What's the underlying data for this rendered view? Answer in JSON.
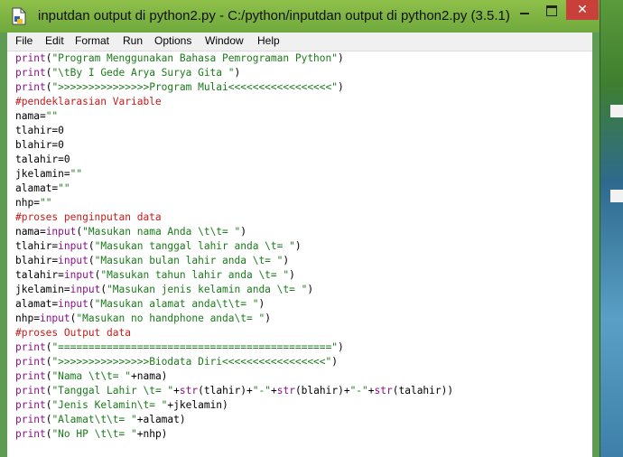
{
  "window": {
    "title": "inputdan output di python2.py - C:/python/inputdan output di python2.py (3.5.1)",
    "close_symbol": "✕"
  },
  "menu": [
    "File",
    "Edit",
    "Format",
    "Run",
    "Options",
    "Window",
    "Help"
  ],
  "colors": {
    "keyword": "#8b0f8b",
    "string": "#1a7a1a",
    "comment": "#c81a1a",
    "titlebar": "#7db443",
    "close": "#c7403a"
  },
  "code_lines": [
    [
      [
        "kw",
        "print"
      ],
      [
        "plain",
        "("
      ],
      [
        "str",
        "\"Program Menggunakan Bahasa Pemrograman Python\""
      ],
      [
        "plain",
        ")"
      ]
    ],
    [
      [
        "kw",
        "print"
      ],
      [
        "plain",
        "("
      ],
      [
        "str",
        "\"\\tBy I Gede Arya Surya Gita \""
      ],
      [
        "plain",
        ")"
      ]
    ],
    [
      [
        "kw",
        "print"
      ],
      [
        "plain",
        "("
      ],
      [
        "str",
        "\">>>>>>>>>>>>>>>Program Mulai<<<<<<<<<<<<<<<<<\""
      ],
      [
        "plain",
        ")"
      ]
    ],
    [
      [
        "cmt",
        "#pendeklarasian Variable"
      ]
    ],
    [
      [
        "plain",
        "nama="
      ],
      [
        "str",
        "\"\""
      ]
    ],
    [
      [
        "plain",
        "tlahir=0"
      ]
    ],
    [
      [
        "plain",
        "blahir=0"
      ]
    ],
    [
      [
        "plain",
        "talahir=0"
      ]
    ],
    [
      [
        "plain",
        "jkelamin="
      ],
      [
        "str",
        "\"\""
      ]
    ],
    [
      [
        "plain",
        "alamat="
      ],
      [
        "str",
        "\"\""
      ]
    ],
    [
      [
        "plain",
        "nhp="
      ],
      [
        "str",
        "\"\""
      ]
    ],
    [
      [
        "cmt",
        "#proses penginputan data"
      ]
    ],
    [
      [
        "plain",
        "nama="
      ],
      [
        "kw",
        "input"
      ],
      [
        "plain",
        "("
      ],
      [
        "str",
        "\"Masukan nama Anda \\t\\t= \""
      ],
      [
        "plain",
        ")"
      ]
    ],
    [
      [
        "plain",
        "tlahir="
      ],
      [
        "kw",
        "input"
      ],
      [
        "plain",
        "("
      ],
      [
        "str",
        "\"Masukan tanggal lahir anda \\t= \""
      ],
      [
        "plain",
        ")"
      ]
    ],
    [
      [
        "plain",
        "blahir="
      ],
      [
        "kw",
        "input"
      ],
      [
        "plain",
        "("
      ],
      [
        "str",
        "\"Masukan bulan lahir anda \\t= \""
      ],
      [
        "plain",
        ")"
      ]
    ],
    [
      [
        "plain",
        "talahir="
      ],
      [
        "kw",
        "input"
      ],
      [
        "plain",
        "("
      ],
      [
        "str",
        "\"Masukan tahun lahir anda \\t= \""
      ],
      [
        "plain",
        ")"
      ]
    ],
    [
      [
        "plain",
        "jkelamin="
      ],
      [
        "kw",
        "input"
      ],
      [
        "plain",
        "("
      ],
      [
        "str",
        "\"Masukan jenis kelamin anda \\t= \""
      ],
      [
        "plain",
        ")"
      ]
    ],
    [
      [
        "plain",
        "alamat="
      ],
      [
        "kw",
        "input"
      ],
      [
        "plain",
        "("
      ],
      [
        "str",
        "\"Masukan alamat anda\\t\\t= \""
      ],
      [
        "plain",
        ")"
      ]
    ],
    [
      [
        "plain",
        "nhp="
      ],
      [
        "kw",
        "input"
      ],
      [
        "plain",
        "("
      ],
      [
        "str",
        "\"Masukan no handphone anda\\t= \""
      ],
      [
        "plain",
        ")"
      ]
    ],
    [
      [
        "cmt",
        "#proses Output data"
      ]
    ],
    [
      [
        "kw",
        "print"
      ],
      [
        "plain",
        "("
      ],
      [
        "str",
        "\"=============================================\""
      ],
      [
        "plain",
        ")"
      ]
    ],
    [
      [
        "kw",
        "print"
      ],
      [
        "plain",
        "("
      ],
      [
        "str",
        "\">>>>>>>>>>>>>>>Biodata Diri<<<<<<<<<<<<<<<<<\""
      ],
      [
        "plain",
        ")"
      ]
    ],
    [
      [
        "kw",
        "print"
      ],
      [
        "plain",
        "("
      ],
      [
        "str",
        "\"Nama \\t\\t= \""
      ],
      [
        "plain",
        "+nama)"
      ]
    ],
    [
      [
        "kw",
        "print"
      ],
      [
        "plain",
        "("
      ],
      [
        "str",
        "\"Tanggal Lahir \\t= \""
      ],
      [
        "plain",
        "+"
      ],
      [
        "kw",
        "str"
      ],
      [
        "plain",
        "(tlahir)+"
      ],
      [
        "str",
        "\"-\""
      ],
      [
        "plain",
        "+"
      ],
      [
        "kw",
        "str"
      ],
      [
        "plain",
        "(blahir)+"
      ],
      [
        "str",
        "\"-\""
      ],
      [
        "plain",
        "+"
      ],
      [
        "kw",
        "str"
      ],
      [
        "plain",
        "(talahir))"
      ]
    ],
    [
      [
        "kw",
        "print"
      ],
      [
        "plain",
        "("
      ],
      [
        "str",
        "\"Jenis Kelamin\\t= \""
      ],
      [
        "plain",
        "+jkelamin)"
      ]
    ],
    [
      [
        "kw",
        "print"
      ],
      [
        "plain",
        "("
      ],
      [
        "str",
        "\"Alamat\\t\\t= \""
      ],
      [
        "plain",
        "+alamat)"
      ]
    ],
    [
      [
        "kw",
        "print"
      ],
      [
        "plain",
        "("
      ],
      [
        "str",
        "\"No HP \\t\\t= \""
      ],
      [
        "plain",
        "+nhp)"
      ]
    ]
  ]
}
